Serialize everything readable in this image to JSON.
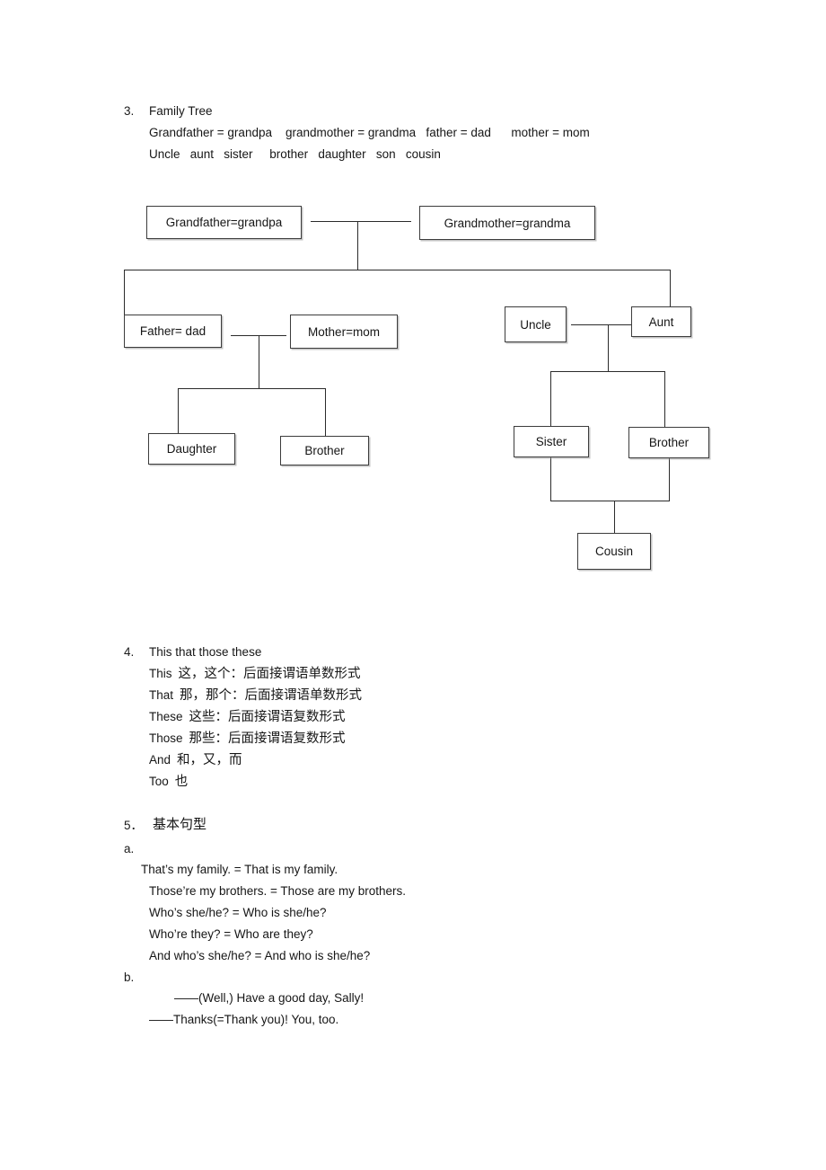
{
  "document": {
    "sections": [
      {
        "number": "3.",
        "title": "Family Tree",
        "lines": [
          "Grandfather = grandpa    grandmother = grandma   father = dad      mother = mom",
          "Uncle   aunt   sister     brother   daughter   son   cousin"
        ]
      },
      {
        "number": "4.",
        "title": "This that those these",
        "entries": [
          {
            "en": "This",
            "zh": "这，这个：后面接谓语单数形式"
          },
          {
            "en": "That",
            "zh": "那，那个：后面接谓语单数形式"
          },
          {
            "en": "These",
            "zh": "这些：后面接谓语复数形式"
          },
          {
            "en": "Those",
            "zh": "那些：后面接谓语复数形式"
          },
          {
            "en": "And",
            "zh": "和，又，而"
          },
          {
            "en": "Too",
            "zh": "也"
          }
        ]
      },
      {
        "number": "5．",
        "title": "基本句型",
        "sub_a_label": "a.",
        "sub_a_lines": [
          "That’s my family. = That is my family.",
          "Those’re my brothers. = Those are my brothers.",
          "Who’s she/he? = Who is she/he?",
          "Who’re they? = Who are they?",
          "And who’s she/he? = And who is she/he?"
        ],
        "sub_b_label": "b.",
        "sub_b_lines": [
          "——(Well,) Have a good day, Sally!",
          "——Thanks(=Thank you)! You, too."
        ]
      }
    ]
  },
  "family_tree": {
    "nodes": {
      "grandfather": "Grandfather=grandpa",
      "grandmother": "Grandmother=grandma",
      "father": "Father= dad",
      "mother": "Mother=mom",
      "uncle": "Uncle",
      "aunt": "Aunt",
      "daughter": "Daughter",
      "brother_left": "Brother",
      "sister": "Sister",
      "brother_right": "Brother",
      "cousin": "Cousin"
    },
    "colors": {
      "box_border": "#3c3c3c",
      "connector": "#2b2b2b",
      "background": "#ffffff",
      "text": "#161616"
    }
  }
}
